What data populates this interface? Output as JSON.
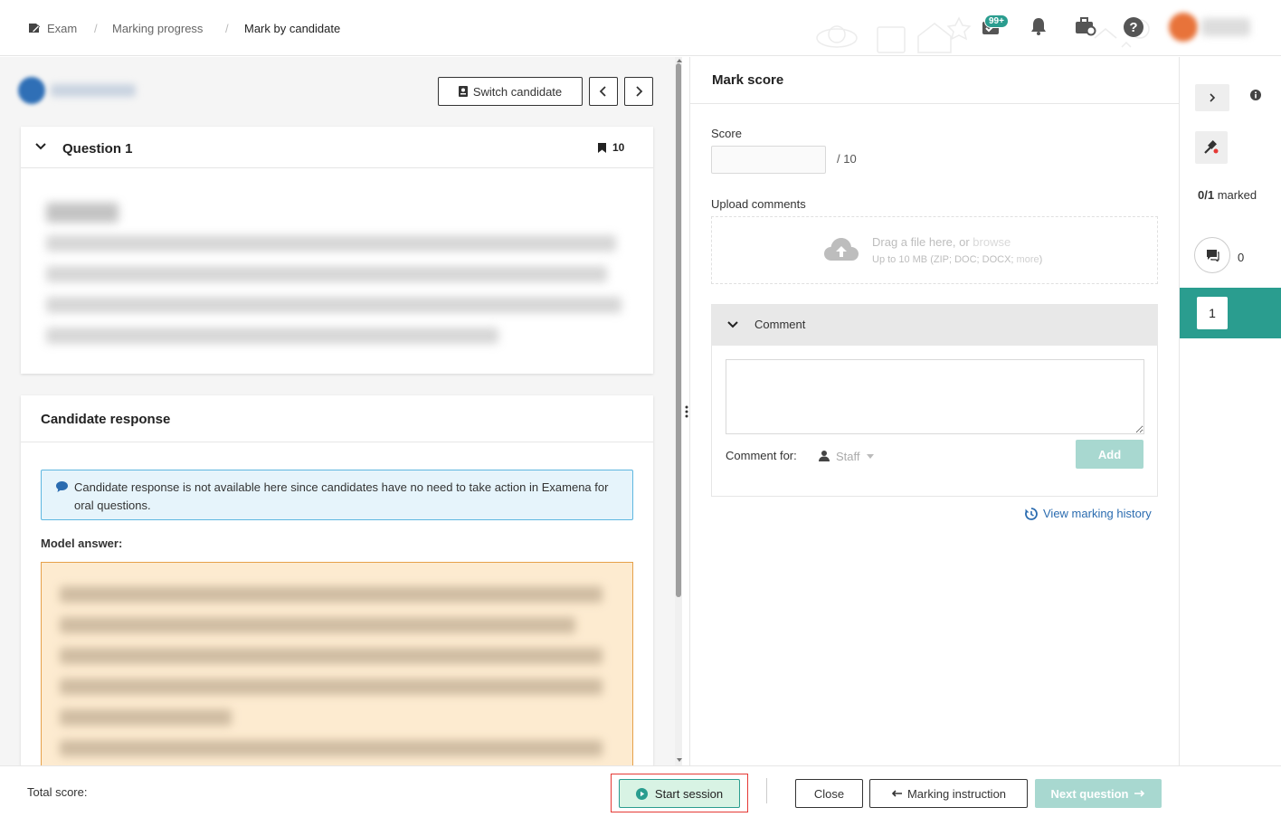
{
  "breadcrumb": {
    "items": [
      "Exam",
      "Marking progress",
      "Mark by candidate"
    ]
  },
  "header": {
    "notifications_badge": "99+"
  },
  "candidate_bar": {
    "switch_label": "Switch candidate"
  },
  "question": {
    "title": "Question 1",
    "marks": "10"
  },
  "response": {
    "title": "Candidate response",
    "info_text": "Candidate response is not available here since candidates have no need to take action in Examena for oral questions.",
    "model_answer_label": "Model answer:"
  },
  "mark_panel": {
    "title": "Mark score",
    "score_label": "Score",
    "score_value": "",
    "score_max": "/ 10",
    "upload_label": "Upload comments",
    "upload_text": "Drag a file here, or",
    "upload_browse": "browse",
    "upload_hint": "Up to 10 MB (ZIP; DOC; DOCX;",
    "upload_more": "more",
    "upload_hint_end": ")",
    "comment_header": "Comment",
    "comment_value": "",
    "comment_for_label": "Comment for:",
    "comment_for_value": "Staff",
    "add_label": "Add",
    "history_label": "View marking history"
  },
  "rail": {
    "marked_count": "0/1",
    "marked_label": "marked",
    "comments_count": "0",
    "question_number": "1"
  },
  "footer": {
    "total_label": "Total score:",
    "start_label": "Start session",
    "close_label": "Close",
    "instruction_label": "Marking instruction",
    "next_label": "Next question"
  },
  "colors": {
    "accent": "#2a9d8f",
    "info_bg": "#e6f4fb",
    "info_border": "#5fb7e0",
    "model_bg": "#fdebd0",
    "model_border": "#e6a14a",
    "start_bg": "#d8f3e4",
    "highlight_red": "#e53935"
  }
}
